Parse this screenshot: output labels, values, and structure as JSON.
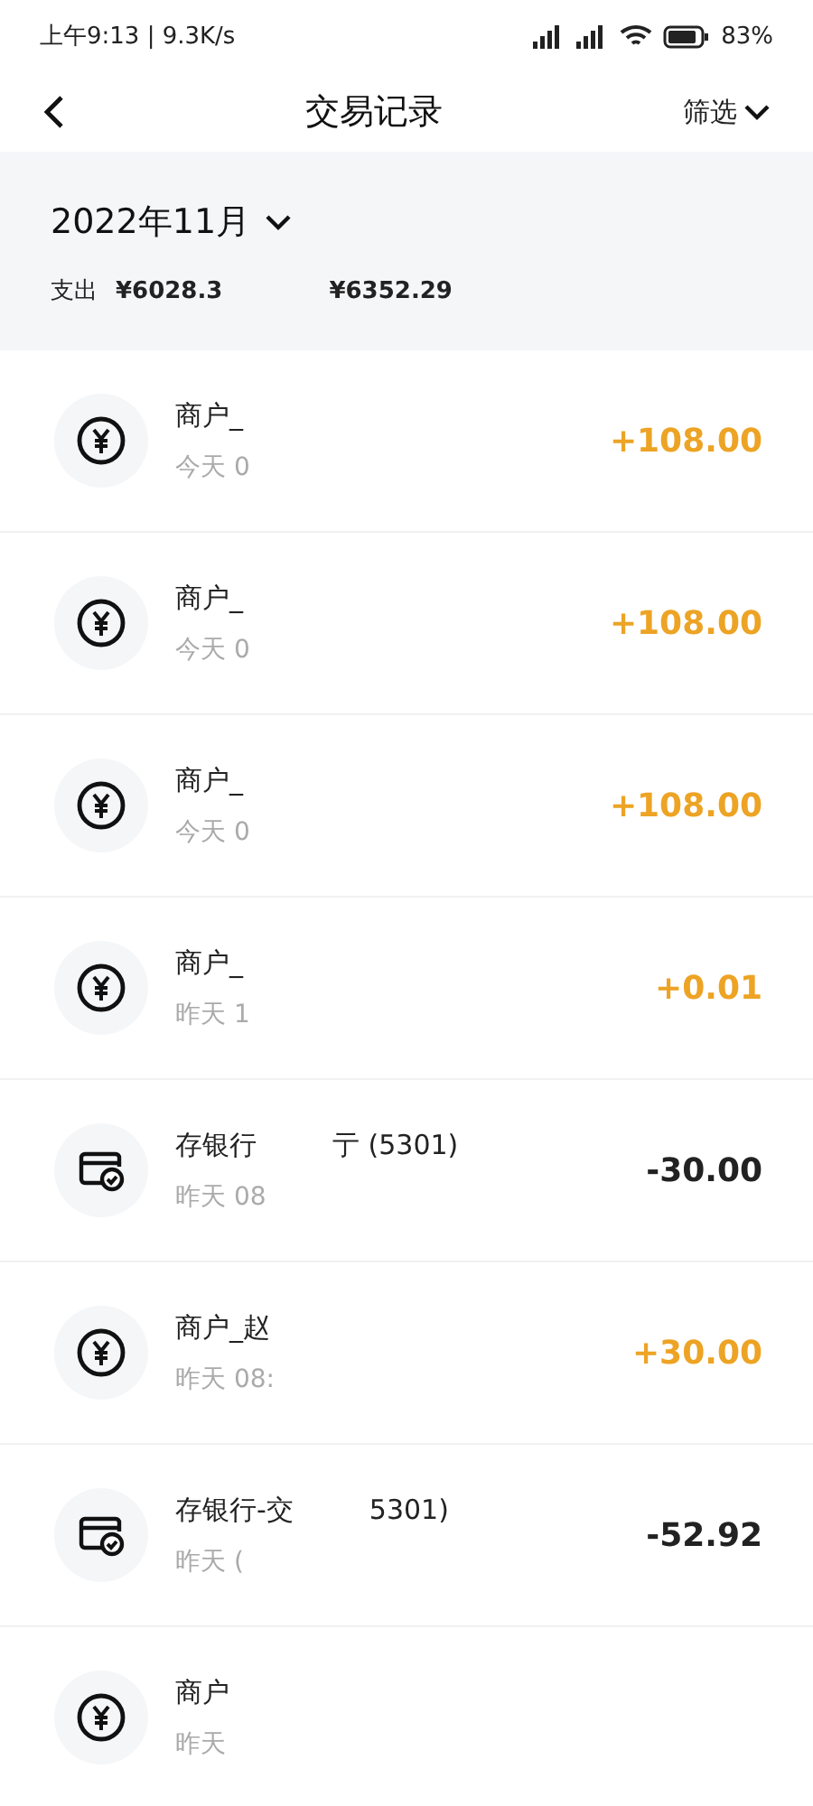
{
  "status_bar": {
    "time": "上午9:13 | 9.3K/s",
    "battery": "83%"
  },
  "header": {
    "title": "交易记录",
    "filter": "筛选"
  },
  "summary": {
    "month": "2022年11月",
    "expense_label": "支出",
    "expense": "¥6028.3",
    "income": "¥6352.29"
  },
  "transactions": [
    {
      "kind": "merchant",
      "title": "商户_",
      "time": "今天 0",
      "amount": "+108.00",
      "income": true
    },
    {
      "kind": "merchant",
      "title": "商户_",
      "time": "今天 0",
      "amount": "+108.00",
      "income": true
    },
    {
      "kind": "merchant",
      "title": "商户_",
      "time": "今天 0",
      "amount": "+108.00",
      "income": true
    },
    {
      "kind": "merchant",
      "title": "商户_",
      "time": "昨天 1",
      "amount": "+0.01",
      "income": true
    },
    {
      "kind": "bank",
      "title": "存银行",
      "title_tail": "亍 (5301)",
      "time": "昨天 08",
      "amount": "-30.00",
      "income": false
    },
    {
      "kind": "merchant",
      "title": "商户_赵",
      "time": "昨天 08:",
      "amount": "+30.00",
      "income": true
    },
    {
      "kind": "bank",
      "title": "存银行-交",
      "title_tail": "5301)",
      "time": "昨天 (",
      "amount": "-52.92",
      "income": false
    },
    {
      "kind": "merchant",
      "title": "商户",
      "time": "昨天"
    }
  ]
}
